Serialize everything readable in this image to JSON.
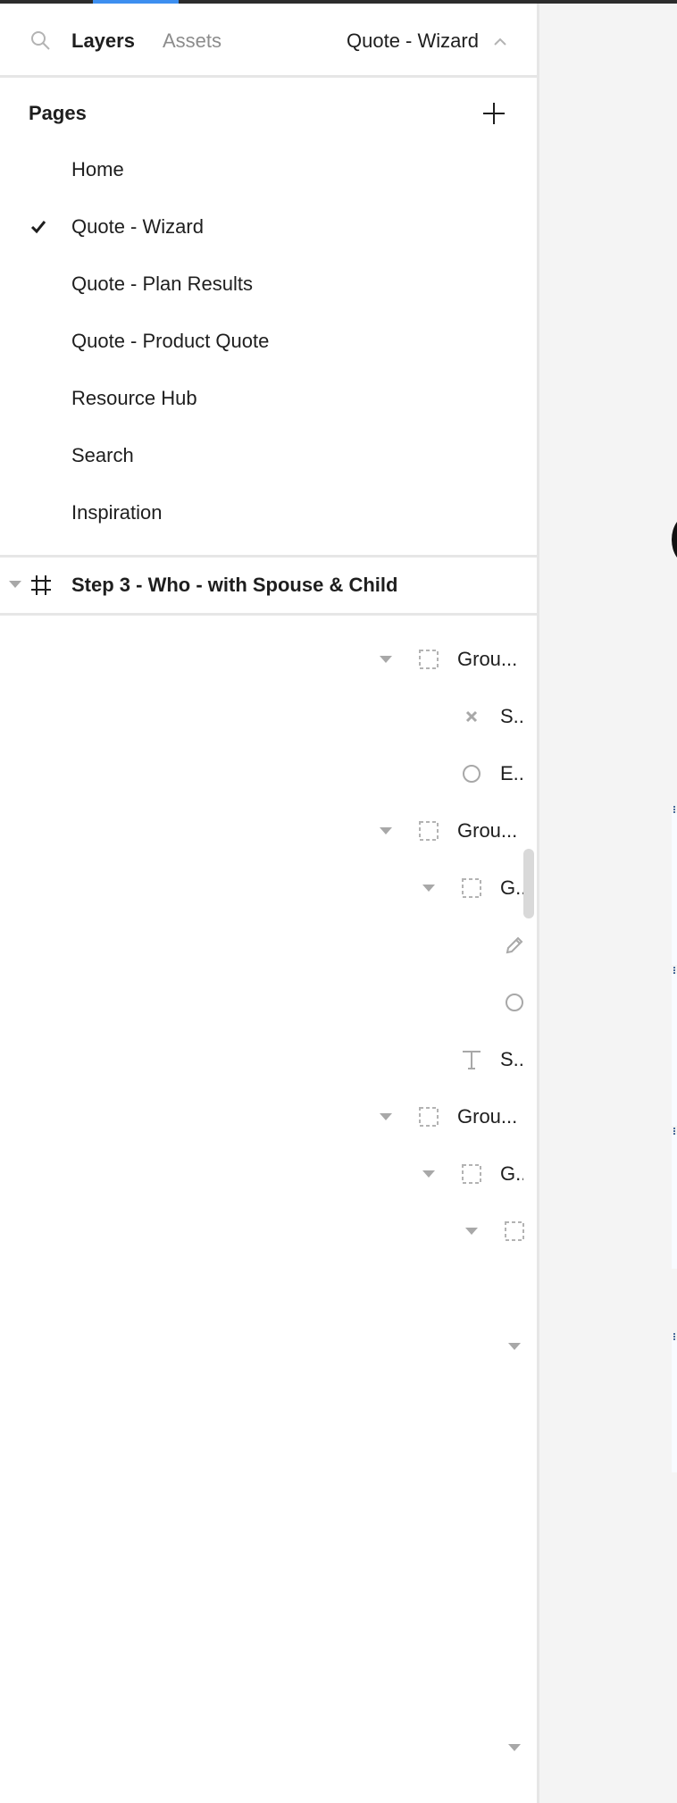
{
  "header": {
    "search_icon": "search-icon",
    "tabs": [
      {
        "label": "Layers",
        "active": true
      },
      {
        "label": "Assets",
        "active": false
      }
    ],
    "current_page": "Quote - Wizard",
    "page_switch_icon": "chevron-up-icon"
  },
  "colors": {
    "accent": "#3d8ff0",
    "topbar": "#2c2c2c",
    "panel_bg": "#ffffff",
    "canvas_bg": "#f4f4f4",
    "divider": "#e6e6e6",
    "muted_text": "#8c8c8c",
    "icon_gray": "#a8a8a8"
  },
  "pages": {
    "title": "Pages",
    "add_icon": "plus-icon",
    "items": [
      {
        "label": "Home",
        "selected": false
      },
      {
        "label": "Quote - Wizard",
        "selected": true
      },
      {
        "label": "Quote - Plan Results",
        "selected": false
      },
      {
        "label": "Quote - Product Quote",
        "selected": false
      },
      {
        "label": "Resource Hub",
        "selected": false
      },
      {
        "label": "Search",
        "selected": false
      },
      {
        "label": "Inspiration",
        "selected": false
      }
    ]
  },
  "frame": {
    "label": "Step 3 - Who - with Spouse & Child",
    "icon": "frame-icon",
    "expanded": true
  },
  "layers": [
    {
      "label": "Grou...",
      "icon": "group-icon",
      "expanded": true
    },
    {
      "label": "S..",
      "icon": "close-icon"
    },
    {
      "label": "E..",
      "icon": "ellipse-icon"
    },
    {
      "label": "Grou...",
      "icon": "group-icon",
      "expanded": true
    },
    {
      "label": "G..",
      "icon": "group-icon",
      "expanded": true
    },
    {
      "label": "",
      "icon": "pencil-icon"
    },
    {
      "label": "",
      "icon": "ellipse-icon"
    },
    {
      "label": "S..",
      "icon": "text-icon"
    },
    {
      "label": "Grou...",
      "icon": "group-icon",
      "expanded": true
    },
    {
      "label": "G..",
      "icon": "group-icon",
      "expanded": true
    },
    {
      "label": "",
      "icon": "group-icon",
      "expanded": true
    }
  ]
}
